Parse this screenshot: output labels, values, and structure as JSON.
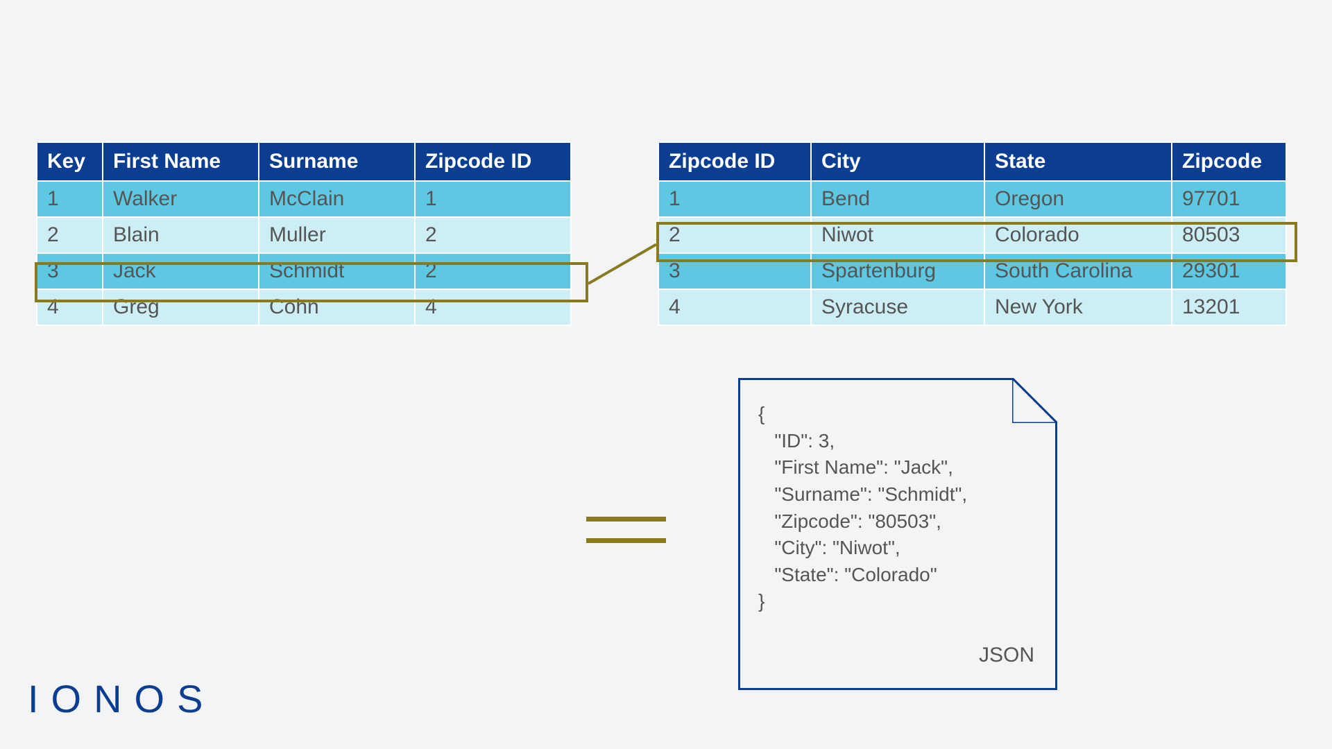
{
  "table_left": {
    "headers": [
      "Key",
      "First Name",
      "Surname",
      "Zipcode ID"
    ],
    "rows": [
      [
        "1",
        "Walker",
        "McClain",
        "1"
      ],
      [
        "2",
        "Blain",
        "Muller",
        "2"
      ],
      [
        "3",
        "Jack",
        "Schmidt",
        "2"
      ],
      [
        "4",
        "Greg",
        "Cohn",
        "4"
      ]
    ]
  },
  "table_right": {
    "headers": [
      "Zipcode ID",
      "City",
      "State",
      "Zipcode"
    ],
    "rows": [
      [
        "1",
        "Bend",
        "Oregon",
        "97701"
      ],
      [
        "2",
        "Niwot",
        "Colorado",
        "80503"
      ],
      [
        "3",
        "Spartenburg",
        "South Carolina",
        "29301"
      ],
      [
        "4",
        "Syracuse",
        "New York",
        "13201"
      ]
    ]
  },
  "json_doc": {
    "lines": [
      "{",
      "   \"ID\": 3,",
      "   \"First Name\": \"Jack\",",
      "   \"Surname\": \"Schmidt\",",
      "   \"Zipcode\": \"80503\",",
      "   \"City\": \"Niwot\",",
      "   \"State\": \"Colorado\"",
      "}"
    ],
    "label": "JSON"
  },
  "logo": "IONOS"
}
